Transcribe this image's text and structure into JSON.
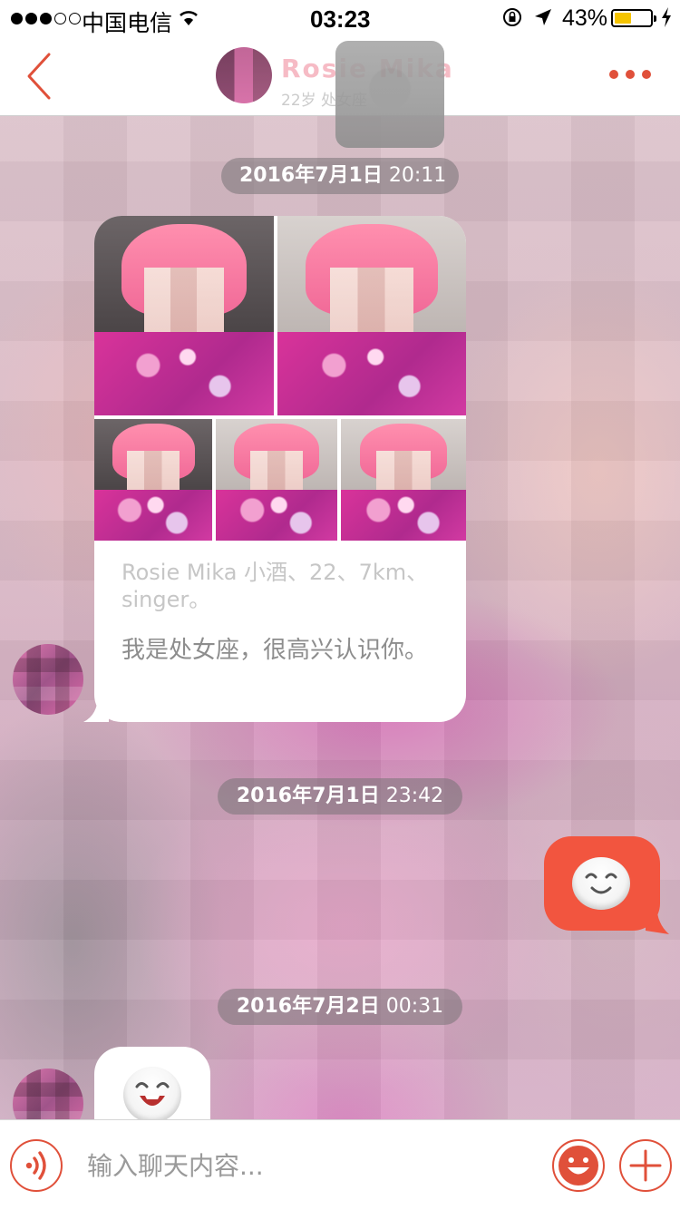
{
  "status_bar": {
    "carrier": "中国电信",
    "time": "03:23",
    "battery_percent": "43%",
    "battery_level": 0.43,
    "signal_bars": 3,
    "signal_total": 5,
    "icons": [
      "signal-dots",
      "wifi-icon",
      "rotation-lock-icon",
      "location-arrow-icon",
      "battery-icon",
      "charging-bolt-icon"
    ]
  },
  "nav": {
    "back_icon": "chevron-left-icon",
    "title": "Rosie Mika 小酒",
    "subtitle": "22岁 处女座",
    "more_icon": "ellipsis-icon",
    "accent_color": "#e0503a"
  },
  "messages": [
    {
      "type": "timestamp",
      "date": "2016年7月1日",
      "time": "20:11"
    },
    {
      "type": "profile-card",
      "direction": "incoming",
      "intro": "Rosie Mika 小酒、22、7km、singer。",
      "text": "我是处女座，很高兴认识你。"
    },
    {
      "type": "timestamp",
      "date": "2016年7月1日",
      "time": "23:42"
    },
    {
      "type": "emoji",
      "direction": "outgoing",
      "emoji": "smile-emoji",
      "bubble_color": "#f2553f"
    },
    {
      "type": "timestamp",
      "date": "2016年7月2日",
      "time": "00:31"
    },
    {
      "type": "emoji",
      "direction": "incoming",
      "emoji": "laugh-emoji"
    }
  ],
  "input": {
    "placeholder": "输入聊天内容...",
    "value": "",
    "voice_icon": "voice-icon",
    "emoji_icon": "emoji-face-icon",
    "plus_icon": "plus-icon"
  }
}
